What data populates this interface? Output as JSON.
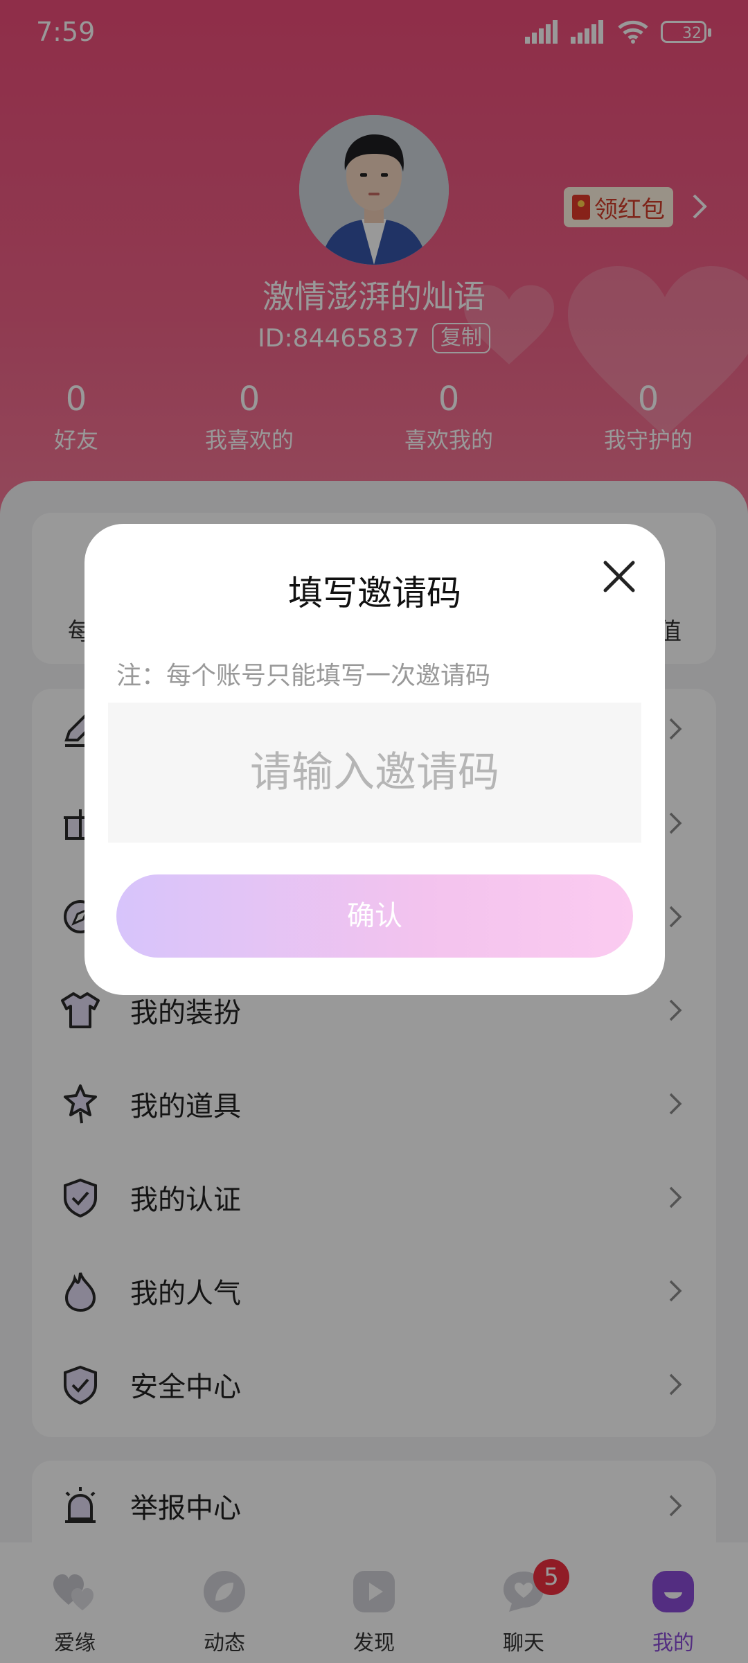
{
  "status_bar": {
    "time": "7:59",
    "battery": "32"
  },
  "profile": {
    "nickname": "激情澎湃的灿语",
    "id_text": "ID:84465837",
    "copy_label": "复制",
    "red_packet_label": "领红包"
  },
  "stats": [
    {
      "value": "0",
      "label": "好友"
    },
    {
      "value": "0",
      "label": "我喜欢的"
    },
    {
      "value": "0",
      "label": "喜欢我的"
    },
    {
      "value": "0",
      "label": "我守护的"
    }
  ],
  "vip_card": {
    "left_text": "每",
    "right_text": "值"
  },
  "menu": [
    {
      "label": "",
      "icon": "edit-icon"
    },
    {
      "label": "",
      "icon": "gift-icon"
    },
    {
      "label": "",
      "icon": "compass-icon"
    },
    {
      "label": "我的装扮",
      "icon": "shirt-icon"
    },
    {
      "label": "我的道具",
      "icon": "star-wand-icon"
    },
    {
      "label": "我的认证",
      "icon": "shield-check-icon"
    },
    {
      "label": "我的人气",
      "icon": "flame-icon"
    },
    {
      "label": "安全中心",
      "icon": "security-shield-icon"
    }
  ],
  "report": {
    "label": "举报中心",
    "icon": "alarm-icon"
  },
  "bottom_nav": [
    {
      "label": "爱缘",
      "icon": "hearts-icon"
    },
    {
      "label": "动态",
      "icon": "leaf-icon"
    },
    {
      "label": "发现",
      "icon": "play-icon"
    },
    {
      "label": "聊天",
      "icon": "chat-heart-icon",
      "badge": "5"
    },
    {
      "label": "我的",
      "icon": "profile-face-icon"
    }
  ],
  "dialog": {
    "title": "填写邀请码",
    "note": "注：每个账号只能填写一次邀请码",
    "input_placeholder": "请输入邀请码",
    "input_value": "",
    "confirm_label": "确认"
  },
  "colors": {
    "header": "#ee4d7a",
    "accent": "#8a4bd8",
    "badge": "#f03040",
    "confirm_start": "#d7c4fb",
    "confirm_end": "#fbcbf0"
  }
}
